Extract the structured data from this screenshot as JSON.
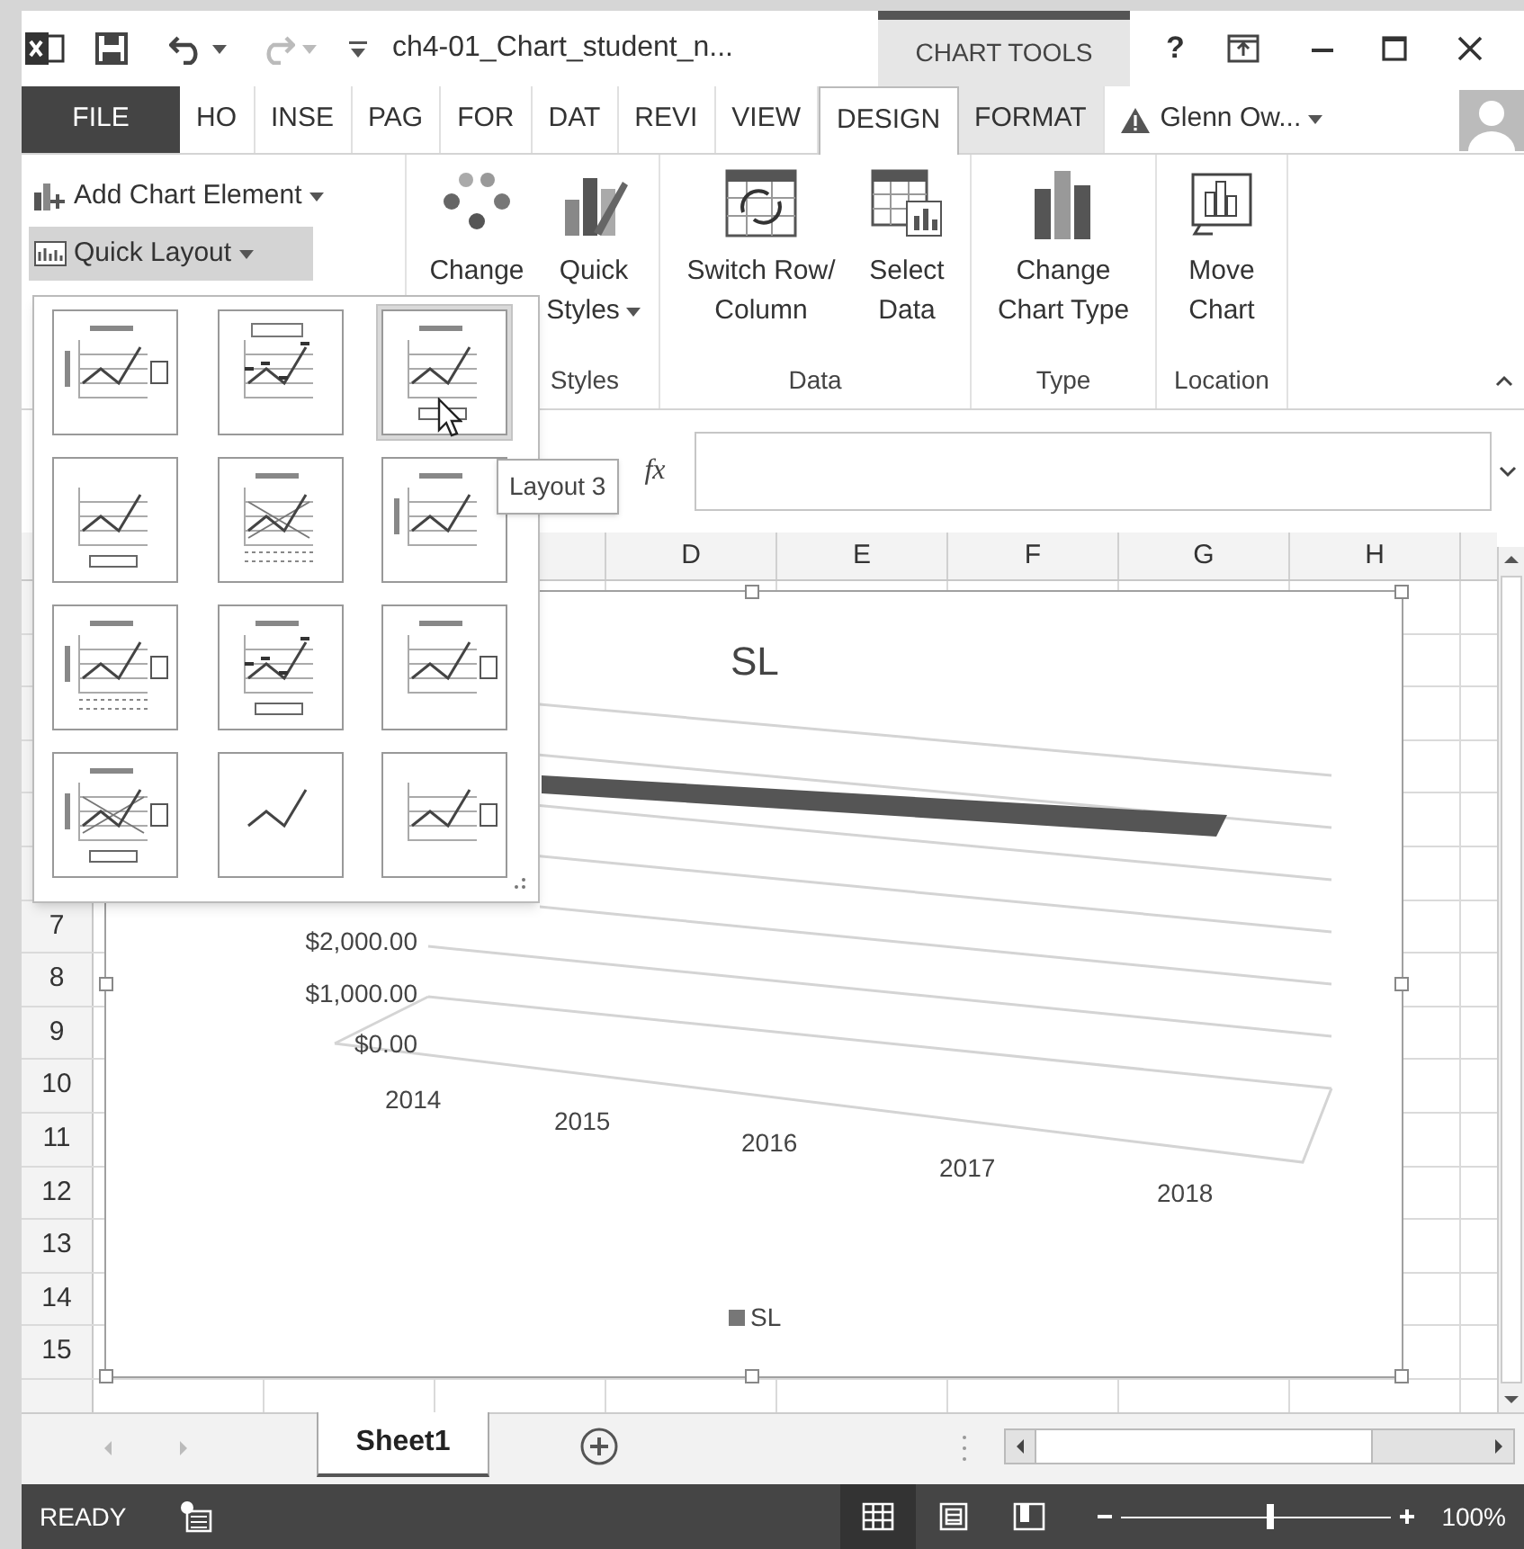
{
  "title_bar": {
    "title": "ch4-01_Chart_student_n...",
    "context_label": "CHART TOOLS",
    "help": "?"
  },
  "tabs": [
    {
      "label": "FILE",
      "kind": "file",
      "selected": false
    },
    {
      "label": "HO",
      "kind": "standard",
      "selected": false
    },
    {
      "label": "INSE",
      "kind": "standard",
      "selected": false
    },
    {
      "label": "PAG",
      "kind": "standard",
      "selected": false
    },
    {
      "label": "FOR",
      "kind": "standard",
      "selected": false
    },
    {
      "label": "DAT",
      "kind": "standard",
      "selected": false
    },
    {
      "label": "REVI",
      "kind": "standard",
      "selected": false
    },
    {
      "label": "VIEW",
      "kind": "standard",
      "selected": false
    },
    {
      "label": "DESIGN",
      "kind": "contextual",
      "selected": true
    },
    {
      "label": "FORMAT",
      "kind": "contextual",
      "selected": false
    }
  ],
  "account": {
    "name": "Glenn Ow..."
  },
  "ribbon": {
    "add_chart_element": "Add Chart Element",
    "quick_layout": {
      "label": "Quick Layout",
      "pressed": true
    },
    "groups": [
      {
        "label": "Styles",
        "buttons": [
          {
            "label": "Change",
            "kind": "colors",
            "dropdown": false
          },
          {
            "label": "Quick Styles",
            "kind": "styles",
            "dropdown": true
          }
        ]
      },
      {
        "label": "Data",
        "buttons": [
          {
            "label": "Switch Row/ Column",
            "kind": "switch",
            "dropdown": false
          },
          {
            "label": "Select Data",
            "kind": "select",
            "dropdown": false
          }
        ]
      },
      {
        "label": "Type",
        "buttons": [
          {
            "label": "Change Chart Type",
            "kind": "chart_type",
            "dropdown": false
          }
        ]
      },
      {
        "label": "Location",
        "buttons": [
          {
            "label": "Move Chart",
            "kind": "move",
            "dropdown": false
          }
        ]
      }
    ]
  },
  "formula_bar": {
    "function_label": "fx"
  },
  "sheet": {
    "columns": [
      "D",
      "E",
      "F",
      "G",
      "H"
    ],
    "rows": [
      "7",
      "8",
      "9",
      "10",
      "11",
      "12",
      "13",
      "14",
      "15"
    ]
  },
  "chart": {
    "title": "SL",
    "y_axis_labels": [
      "$2,000.00",
      "$1,000.00",
      "$0.00"
    ],
    "x_axis_labels": [
      "2014",
      "2015",
      "2016",
      "2017",
      "2018"
    ],
    "legend": "SL"
  },
  "quick_layout_menu": {
    "layouts": [
      {
        "selected": false
      },
      {
        "selected": false
      },
      {
        "selected": true
      },
      {
        "selected": false
      },
      {
        "selected": false
      },
      {
        "selected": false
      },
      {
        "selected": false
      },
      {
        "selected": false
      },
      {
        "selected": false
      },
      {
        "selected": false
      },
      {
        "selected": false
      },
      {
        "selected": false
      }
    ]
  },
  "tooltip": "Layout 3",
  "sheet_tabs": [
    {
      "label": "Sheet1",
      "selected": true
    }
  ],
  "status_bar": {
    "status": "READY",
    "views": [
      {
        "kind": "normal",
        "selected": true
      },
      {
        "kind": "page_layout",
        "selected": false
      },
      {
        "kind": "page_break",
        "selected": false
      }
    ],
    "zoom": {
      "level": 0.55
    },
    "zoom_label": "100%"
  }
}
